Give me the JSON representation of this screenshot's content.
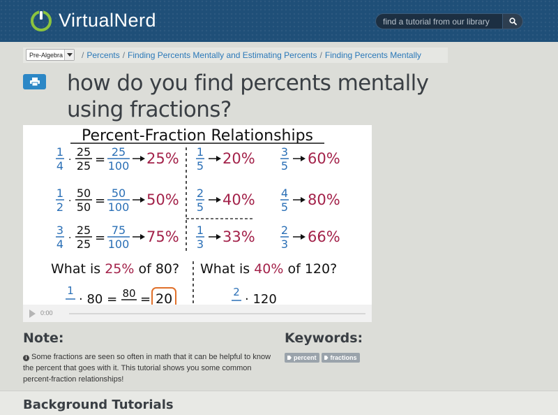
{
  "header": {
    "logo_virtual": "Virtual",
    "logo_nerd": "Nerd",
    "search_placeholder": "find a tutorial from our library",
    "icons": {
      "logo": "power-icon",
      "search": "search-icon"
    }
  },
  "breadcrumb": {
    "subject": "Pre-Algebra",
    "items": [
      {
        "label": "Percents"
      },
      {
        "label": "Finding Percents Mentally and Estimating Percents"
      },
      {
        "label": "Finding Percents Mentally"
      }
    ],
    "separator": "/"
  },
  "page": {
    "title": "how do you find percents mentally using fractions?",
    "print_icon": "printer-icon"
  },
  "video": {
    "board_title": "Percent-Fraction Relationships",
    "rows": [
      {
        "a": {
          "num": "1",
          "den": "4",
          "mul_num": "25",
          "mul_den": "25",
          "res_num": "25",
          "res_den": "100",
          "pct": "25%"
        },
        "b": {
          "num": "1",
          "den": "5",
          "pct": "20%"
        },
        "c": {
          "num": "3",
          "den": "5",
          "pct": "60%"
        }
      },
      {
        "a": {
          "num": "1",
          "den": "2",
          "mul_num": "50",
          "mul_den": "50",
          "res_num": "50",
          "res_den": "100",
          "pct": "50%"
        },
        "b": {
          "num": "2",
          "den": "5",
          "pct": "40%"
        },
        "c": {
          "num": "4",
          "den": "5",
          "pct": "80%"
        }
      },
      {
        "a": {
          "num": "3",
          "den": "4",
          "mul_num": "25",
          "mul_den": "25",
          "res_num": "75",
          "res_den": "100",
          "pct": "75%"
        },
        "b": {
          "num": "1",
          "den": "3",
          "pct": "33%"
        },
        "c": {
          "num": "2",
          "den": "3",
          "pct": "66%"
        }
      }
    ],
    "q1_prefix": "What is ",
    "q1_pct": "25%",
    "q1_suffix": " of 80?",
    "q2_prefix": "What is ",
    "q2_pct": "40%",
    "q2_suffix": " of 120?",
    "work1_num": "1",
    "work1_rest": "· 80 = ",
    "work1_num2": "80",
    "work1_eq": "=",
    "work1_ans": "20",
    "work2_num": "2",
    "work2_rest": "· 120",
    "time": "0:00",
    "colors": {
      "blue": "#2a6fb6",
      "red": "#a3224a",
      "black": "#111111"
    }
  },
  "note": {
    "heading": "Note:",
    "text": "Some fractions are seen so often in math that it can be helpful to know the percent that goes with it. This tutorial shows you some common percent-fraction relationships!"
  },
  "keywords": {
    "heading": "Keywords:",
    "tags": [
      "percent",
      "fractions"
    ]
  },
  "background": {
    "heading": "Background Tutorials"
  }
}
